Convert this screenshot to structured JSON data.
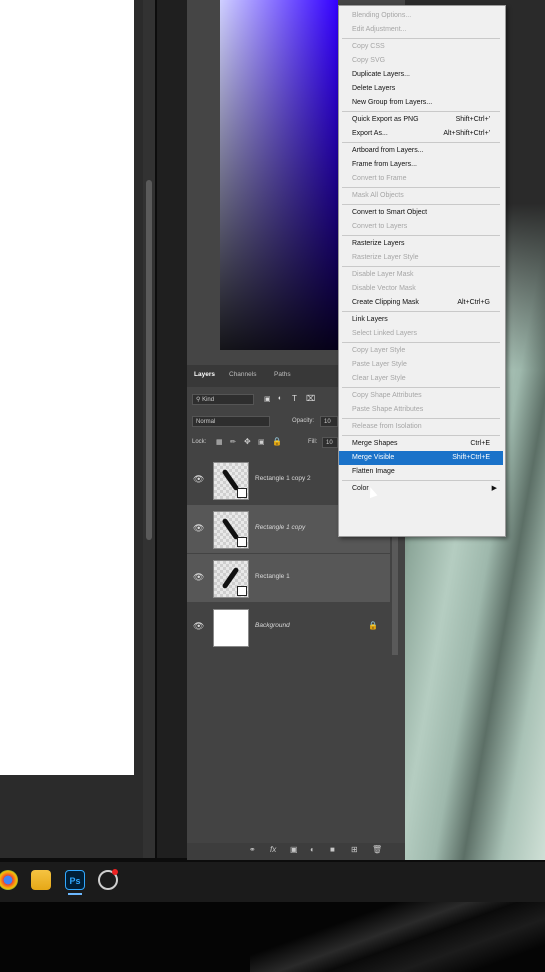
{
  "layers_panel": {
    "tabs": [
      "Layers",
      "Channels",
      "Paths"
    ],
    "filter_label": "Kind",
    "blend_mode": "Normal",
    "opacity_label": "Opacity:",
    "opacity_value": "10",
    "lock_label": "Lock:",
    "fill_label": "Fill:",
    "fill_value": "10",
    "layers": [
      {
        "name": "Rectangle 1 copy 2",
        "selected": false,
        "italic": false
      },
      {
        "name": "Rectangle 1 copy",
        "selected": true,
        "italic": true
      },
      {
        "name": "Rectangle 1",
        "selected": true,
        "italic": false
      },
      {
        "name": "Background",
        "selected": false,
        "italic": true
      }
    ]
  },
  "context_menu": {
    "items": [
      {
        "label": "Blending Options...",
        "shortcut": "",
        "disabled": true
      },
      {
        "label": "Edit Adjustment...",
        "shortcut": "",
        "disabled": true
      },
      {
        "sep": true
      },
      {
        "label": "Copy CSS",
        "shortcut": "",
        "disabled": true
      },
      {
        "label": "Copy SVG",
        "shortcut": "",
        "disabled": true
      },
      {
        "label": "Duplicate Layers...",
        "shortcut": "",
        "disabled": false
      },
      {
        "label": "Delete Layers",
        "shortcut": "",
        "disabled": false
      },
      {
        "label": "New Group from Layers...",
        "shortcut": "",
        "disabled": false
      },
      {
        "sep": true
      },
      {
        "label": "Quick Export as PNG",
        "shortcut": "Shift+Ctrl+'",
        "disabled": false
      },
      {
        "label": "Export As...",
        "shortcut": "Alt+Shift+Ctrl+'",
        "disabled": false
      },
      {
        "sep": true
      },
      {
        "label": "Artboard from Layers...",
        "shortcut": "",
        "disabled": false
      },
      {
        "label": "Frame from Layers...",
        "shortcut": "",
        "disabled": false
      },
      {
        "label": "Convert to Frame",
        "shortcut": "",
        "disabled": true
      },
      {
        "sep": true
      },
      {
        "label": "Mask All Objects",
        "shortcut": "",
        "disabled": true
      },
      {
        "sep": true
      },
      {
        "label": "Convert to Smart Object",
        "shortcut": "",
        "disabled": false
      },
      {
        "label": "Convert to Layers",
        "shortcut": "",
        "disabled": true
      },
      {
        "sep": true
      },
      {
        "label": "Rasterize Layers",
        "shortcut": "",
        "disabled": false
      },
      {
        "label": "Rasterize Layer Style",
        "shortcut": "",
        "disabled": true
      },
      {
        "sep": true
      },
      {
        "label": "Disable Layer Mask",
        "shortcut": "",
        "disabled": true
      },
      {
        "label": "Disable Vector Mask",
        "shortcut": "",
        "disabled": true
      },
      {
        "label": "Create Clipping Mask",
        "shortcut": "Alt+Ctrl+G",
        "disabled": false
      },
      {
        "sep": true
      },
      {
        "label": "Link Layers",
        "shortcut": "",
        "disabled": false
      },
      {
        "label": "Select Linked Layers",
        "shortcut": "",
        "disabled": true
      },
      {
        "sep": true
      },
      {
        "label": "Copy Layer Style",
        "shortcut": "",
        "disabled": true
      },
      {
        "label": "Paste Layer Style",
        "shortcut": "",
        "disabled": true
      },
      {
        "label": "Clear Layer Style",
        "shortcut": "",
        "disabled": true
      },
      {
        "sep": true
      },
      {
        "label": "Copy Shape Attributes",
        "shortcut": "",
        "disabled": true
      },
      {
        "label": "Paste Shape Attributes",
        "shortcut": "",
        "disabled": true
      },
      {
        "sep": true
      },
      {
        "label": "Release from Isolation",
        "shortcut": "",
        "disabled": true
      },
      {
        "sep": true
      },
      {
        "label": "Merge Shapes",
        "shortcut": "Ctrl+E",
        "disabled": false
      },
      {
        "label": "Merge Visible",
        "shortcut": "Shift+Ctrl+E",
        "disabled": false,
        "highlighted": true
      },
      {
        "label": "Flatten Image",
        "shortcut": "",
        "disabled": false
      },
      {
        "sep": true
      },
      {
        "label": "Color",
        "shortcut": "",
        "disabled": false,
        "submenu": true
      }
    ]
  },
  "taskbar": {
    "icons": [
      "chrome-icon",
      "file-explorer-icon",
      "photoshop-icon",
      "recorder-icon"
    ],
    "ps_label": "Ps"
  },
  "colors": {
    "menu_highlight": "#1a72c9",
    "panel_bg": "#434343",
    "selected_row": "#575757"
  }
}
